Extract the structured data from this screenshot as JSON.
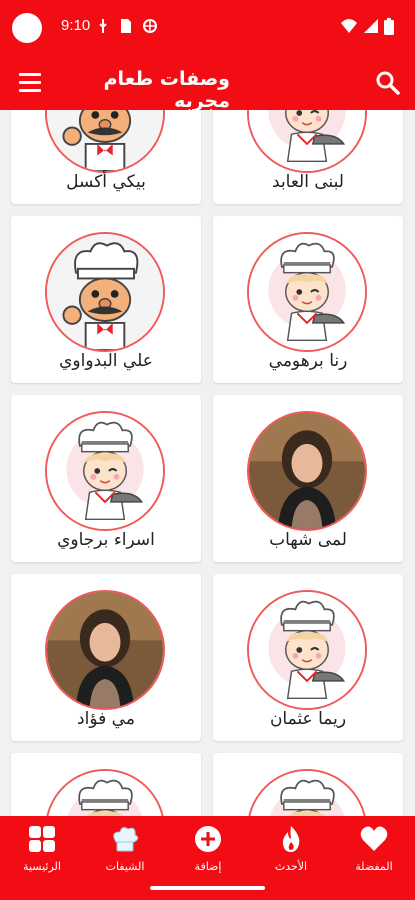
{
  "status_bar": {
    "time": "9:10"
  },
  "app_bar": {
    "title": "وصفات طعام مجربه"
  },
  "chefs": [
    {
      "name": "بيكي أكسل",
      "avatar": "cartoon-chef-man-icon"
    },
    {
      "name": "لبنى العابد",
      "avatar": "cartoon-chef-woman-icon"
    },
    {
      "name": "علي البدواوي",
      "avatar": "cartoon-chef-man-icon"
    },
    {
      "name": "رنا برهومي",
      "avatar": "cartoon-chef-woman-icon"
    },
    {
      "name": "اسراء برجاوي",
      "avatar": "cartoon-chef-woman-icon"
    },
    {
      "name": "لمى شهاب",
      "avatar": "chef-photo-woman"
    },
    {
      "name": "مي فؤاد",
      "avatar": "chef-photo-woman"
    },
    {
      "name": "ريما عثمان",
      "avatar": "cartoon-chef-woman-icon"
    }
  ],
  "bottom_nav": {
    "home": "الرئيسية",
    "chefs": "الشيفات",
    "add": "إضافة",
    "latest": "الأحدث",
    "favorites": "المفضلة"
  },
  "colors": {
    "brand": "#f20d14",
    "avatar_border": "#f05a5a"
  }
}
